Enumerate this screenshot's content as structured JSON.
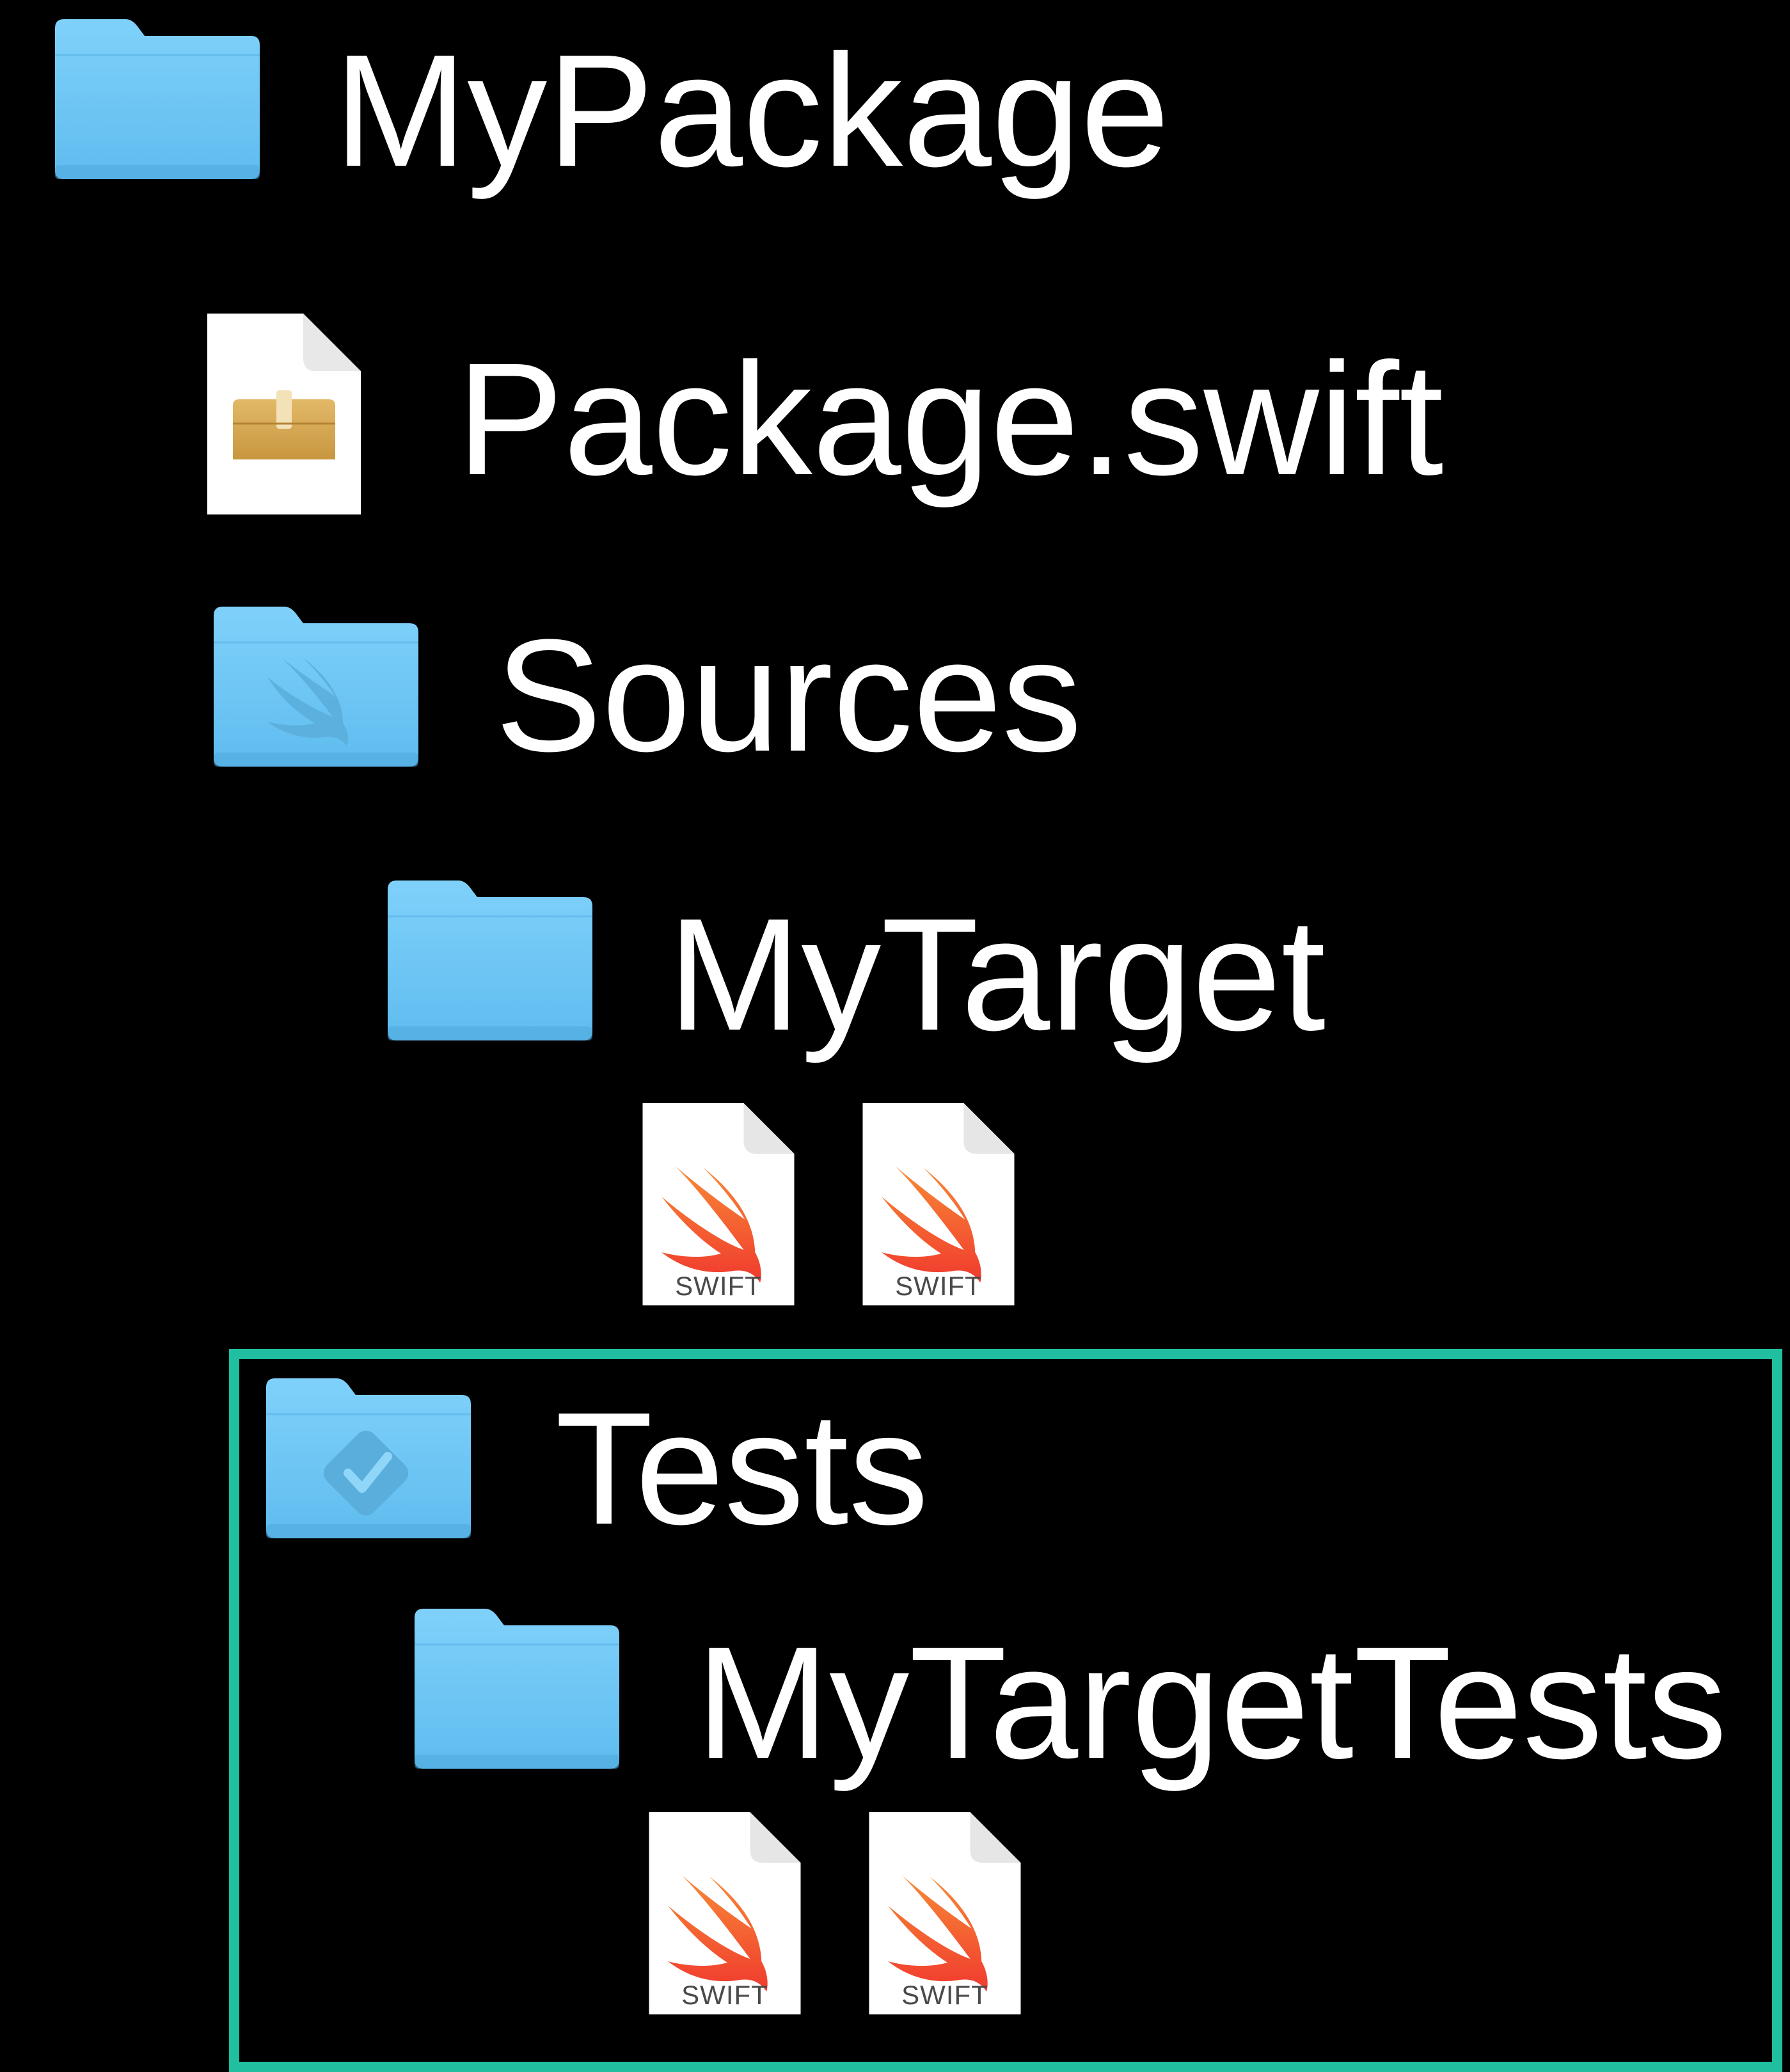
{
  "colors": {
    "background": "#000000",
    "text": "#ffffff",
    "folder_blue": "#6fc7f5",
    "highlight": "#1fbfa0",
    "swift_orange": "#f05138"
  },
  "tree": {
    "root": {
      "label": "MyPackage",
      "icon": "folder-icon"
    },
    "manifest": {
      "label": "Package.swift",
      "icon": "package-manifest-icon"
    },
    "sources": {
      "label": "Sources",
      "icon": "swift-folder-icon"
    },
    "my_target": {
      "label": "MyTarget",
      "icon": "folder-icon"
    },
    "my_target_files": [
      {
        "caption": "SWIFT",
        "icon": "swift-file-icon"
      },
      {
        "caption": "SWIFT",
        "icon": "swift-file-icon"
      }
    ],
    "tests": {
      "label": "Tests",
      "icon": "test-folder-icon"
    },
    "my_target_tests": {
      "label": "MyTargetTests",
      "icon": "folder-icon"
    },
    "my_target_tests_files": [
      {
        "caption": "SWIFT",
        "icon": "swift-file-icon"
      },
      {
        "caption": "SWIFT",
        "icon": "swift-file-icon"
      }
    ]
  }
}
